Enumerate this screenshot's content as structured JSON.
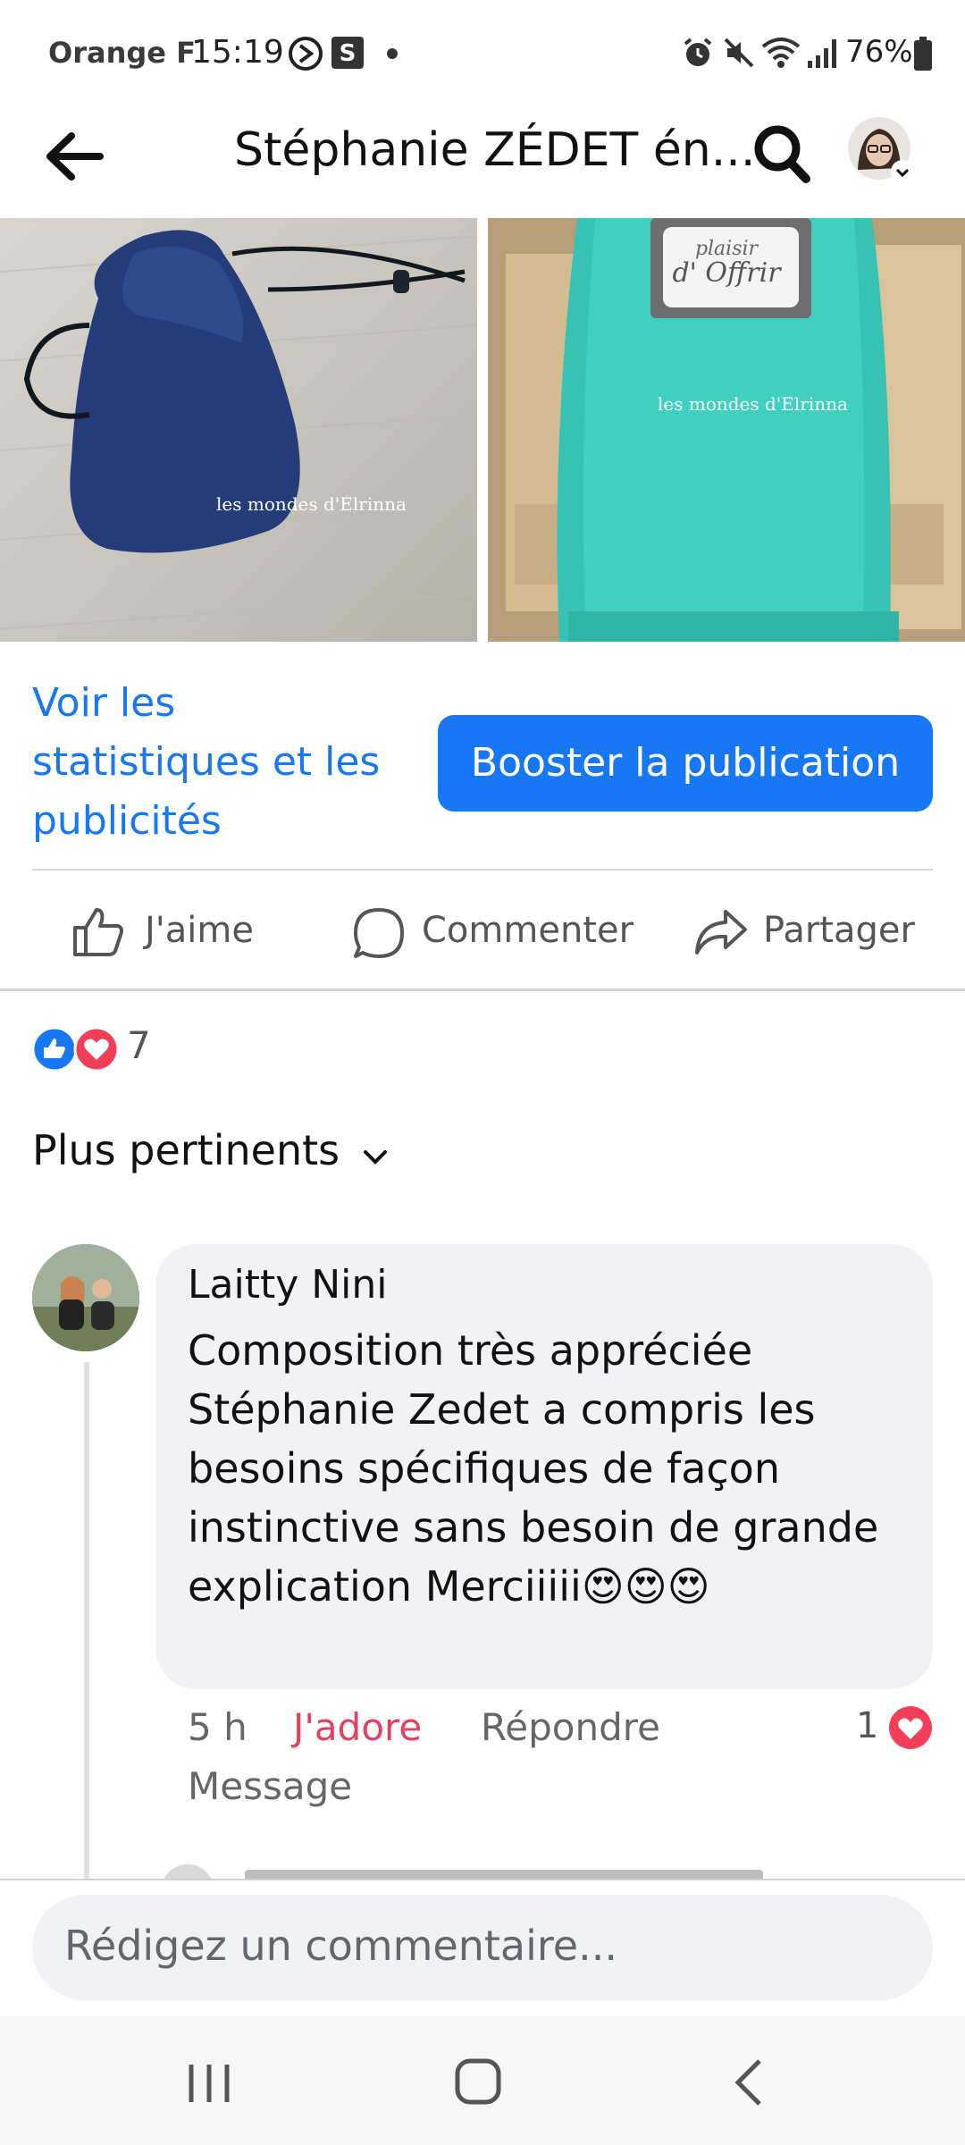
{
  "status_bar": {
    "carrier": "Orange F",
    "time": "15:19",
    "battery": "76%"
  },
  "header": {
    "title": "Stéphanie ZÉDET én..."
  },
  "photos": [
    {
      "watermark": "les mondes d'Elrinna"
    },
    {
      "watermark": "les mondes d'Elrinna",
      "label_line1": "plaisir",
      "label_line2": "d' Offrir"
    }
  ],
  "insights": {
    "stats_link": "Voir les statistiques et les publicités",
    "boost_label": "Booster la publication"
  },
  "actions": {
    "like": "J'aime",
    "comment": "Commenter",
    "share": "Partager"
  },
  "reactions": {
    "count": "7"
  },
  "sort": {
    "label": "Plus pertinents"
  },
  "comment": {
    "author": "Laitty Nini",
    "text": "Composition très appréciée Stéphanie Zedet a compris les besoins spécifiques de façon instinctive sans besoin de grande explication Merciiiii😍😍😍",
    "time": "5 h",
    "reaction_label": "J'adore",
    "reply_label": "Répondre",
    "message_label": "Message",
    "reaction_count": "1"
  },
  "composer": {
    "placeholder": "Rédigez un commentaire..."
  },
  "colors": {
    "brand_blue": "#1877f2",
    "love_red": "#e4405f",
    "bubble_bg": "#f0f2f5"
  },
  "icons": [
    "back-arrow-icon",
    "search-icon",
    "like-icon",
    "comment-icon",
    "share-icon",
    "chevron-down-icon",
    "heart-icon",
    "nav-recents-icon",
    "nav-home-icon",
    "nav-back-icon"
  ]
}
